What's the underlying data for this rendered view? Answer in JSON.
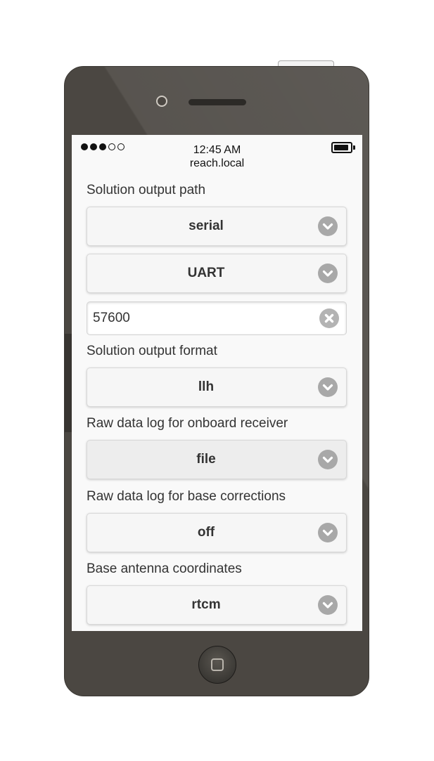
{
  "status_bar": {
    "signal_full": 3,
    "signal_total": 5,
    "time": "12:45 AM",
    "host": "reach.local",
    "battery_level": 0.9
  },
  "form": {
    "solution_output_path": {
      "label": "Solution output path",
      "path_type": "serial",
      "port": "UART",
      "baud_rate": "57600",
      "baud_placeholder": ""
    },
    "solution_output_format": {
      "label": "Solution output format",
      "value": "llh"
    },
    "raw_log_onboard": {
      "label": "Raw data log for onboard receiver",
      "value": "file"
    },
    "raw_log_base": {
      "label": "Raw data log for base corrections",
      "value": "off"
    },
    "base_antenna": {
      "label": "Base antenna coordinates",
      "value": "rtcm"
    }
  },
  "icons": {
    "select_chevron": "chevron-down-icon",
    "clear": "clear-icon",
    "camera": "camera-icon",
    "home": "home-button-icon",
    "battery": "battery-icon"
  },
  "colors": {
    "phone_body": "#4b4742",
    "screen_bg": "#f9f9f9",
    "icon_gray": "#a8a8a8",
    "text": "#333333"
  }
}
